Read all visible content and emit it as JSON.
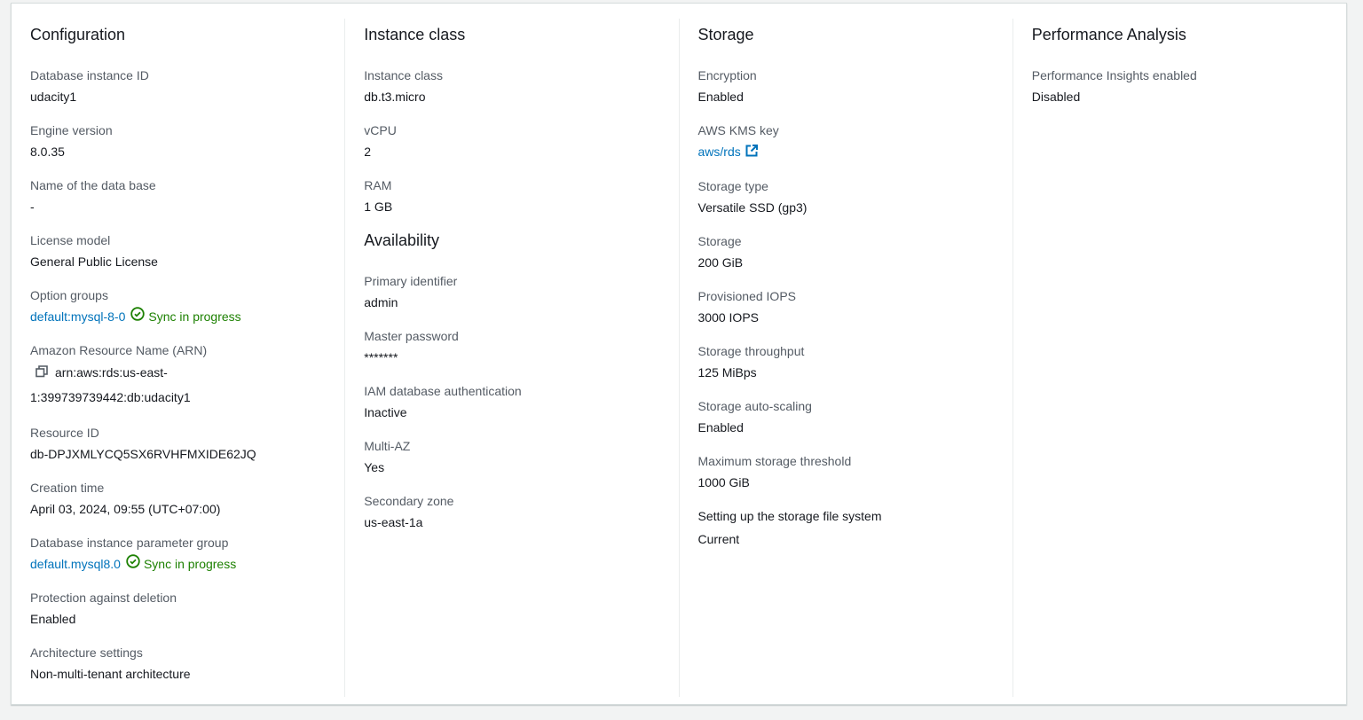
{
  "columns": [
    {
      "sections": [
        {
          "title": "Configuration",
          "items": [
            {
              "label": "Database instance ID",
              "value": "udacity1"
            },
            {
              "label": "Engine version",
              "value": "8.0.35"
            },
            {
              "label": "Name of the data base",
              "value": "-"
            },
            {
              "label": "License model",
              "value": "General Public License"
            },
            {
              "label": "Option groups",
              "value": "default:mysql-8-0",
              "type": "link-status",
              "status": "Sync in progress"
            },
            {
              "label": "Amazon Resource Name (ARN)",
              "value": "arn:aws:rds:us-east-",
              "value2": "1:399739739442:db:udacity1",
              "type": "copy"
            },
            {
              "label": "Resource ID",
              "value": "db-DPJXMLYCQ5SX6RVHFMXIDE62JQ"
            },
            {
              "label": "Creation time",
              "value": "April 03, 2024, 09:55 (UTC+07:00)"
            },
            {
              "label": "Database instance parameter group",
              "value": "default.mysql8.0",
              "type": "link-status",
              "status": "Sync in progress"
            },
            {
              "label": "Protection against deletion",
              "value": "Enabled"
            },
            {
              "label": "Architecture settings",
              "value": "Non-multi-tenant architecture"
            }
          ]
        }
      ]
    },
    {
      "sections": [
        {
          "title": "Instance class",
          "items": [
            {
              "label": "Instance class",
              "value": "db.t3.micro"
            },
            {
              "label": "vCPU",
              "value": "2"
            },
            {
              "label": "RAM",
              "value": "1 GB"
            }
          ]
        },
        {
          "title": "Availability",
          "items": [
            {
              "label": "Primary identifier",
              "value": "admin"
            },
            {
              "label": "Master password",
              "value": "*******"
            },
            {
              "label": "IAM database authentication",
              "value": "Inactive"
            },
            {
              "label": "Multi-AZ",
              "value": "Yes"
            },
            {
              "label": "Secondary zone",
              "value": "us-east-1a"
            }
          ]
        }
      ]
    },
    {
      "sections": [
        {
          "title": "Storage",
          "items": [
            {
              "label": "Encryption",
              "value": "Enabled"
            },
            {
              "label": "AWS KMS key",
              "value": "aws/rds",
              "type": "external-link"
            },
            {
              "label": "Storage type",
              "value": "Versatile SSD (gp3)"
            },
            {
              "label": "Storage",
              "value": "200 GiB"
            },
            {
              "label": "Provisioned IOPS",
              "value": "3000 IOPS"
            },
            {
              "label": "Storage throughput",
              "value": "125 MiBps"
            },
            {
              "label": "Storage auto-scaling",
              "value": "Enabled"
            },
            {
              "label": "Maximum storage threshold",
              "value": "1000 GiB"
            },
            {
              "label": "Setting up the storage file system",
              "value": "Current",
              "type": "dark-label"
            }
          ]
        }
      ]
    },
    {
      "sections": [
        {
          "title": "Performance Analysis",
          "items": [
            {
              "label": "Performance Insights enabled",
              "value": "Disabled"
            }
          ]
        }
      ]
    }
  ],
  "colors": {
    "link": "#0073bb",
    "success": "#1d8102"
  }
}
